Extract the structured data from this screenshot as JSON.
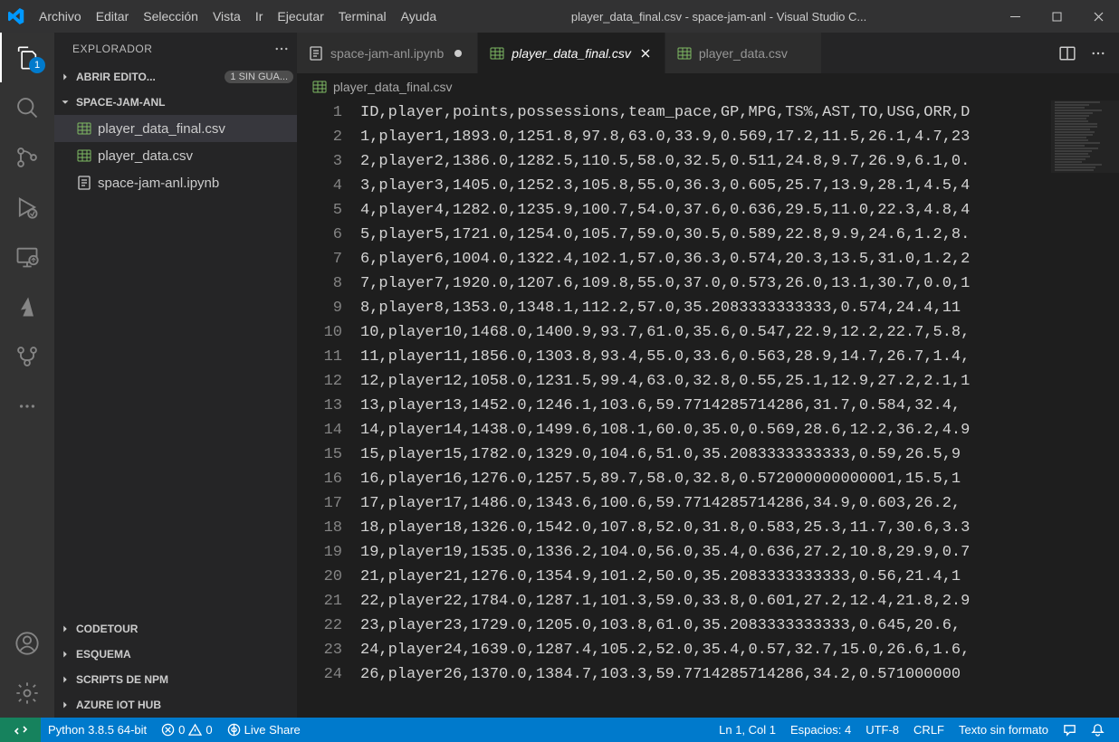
{
  "window": {
    "title": "player_data_final.csv - space-jam-anl - Visual Studio C..."
  },
  "menu": [
    "Archivo",
    "Editar",
    "Selección",
    "Vista",
    "Ir",
    "Ejecutar",
    "Terminal",
    "Ayuda"
  ],
  "activity": {
    "explorer_badge": "1"
  },
  "explorer": {
    "title": "EXPLORADOR",
    "open_editors_label": "ABRIR EDITO...",
    "unsaved_badge": "1 SIN GUA...",
    "folder_name": "SPACE-JAM-ANL",
    "files": [
      {
        "name": "player_data_final.csv",
        "type": "csv",
        "selected": true
      },
      {
        "name": "player_data.csv",
        "type": "csv",
        "selected": false
      },
      {
        "name": "space-jam-anl.ipynb",
        "type": "ipynb",
        "selected": false
      }
    ],
    "panels": [
      "CODETOUR",
      "ESQUEMA",
      "SCRIPTS DE NPM",
      "AZURE IOT HUB"
    ]
  },
  "tabs": [
    {
      "label": "space-jam-anl.ipynb",
      "type": "ipynb",
      "dirty": true,
      "active": false
    },
    {
      "label": "player_data_final.csv",
      "type": "csv",
      "dirty": false,
      "active": true
    },
    {
      "label": "player_data.csv",
      "type": "csv",
      "dirty": false,
      "active": false
    }
  ],
  "breadcrumb": {
    "file": "player_data_final.csv"
  },
  "editor": {
    "lines": [
      "ID,player,points,possessions,team_pace,GP,MPG,TS%,AST,TO,USG,ORR,D",
      "1,player1,1893.0,1251.8,97.8,63.0,33.9,0.569,17.2,11.5,26.1,4.7,23",
      "2,player2,1386.0,1282.5,110.5,58.0,32.5,0.511,24.8,9.7,26.9,6.1,0.",
      "3,player3,1405.0,1252.3,105.8,55.0,36.3,0.605,25.7,13.9,28.1,4.5,4",
      "4,player4,1282.0,1235.9,100.7,54.0,37.6,0.636,29.5,11.0,22.3,4.8,4",
      "5,player5,1721.0,1254.0,105.7,59.0,30.5,0.589,22.8,9.9,24.6,1.2,8.",
      "6,player6,1004.0,1322.4,102.1,57.0,36.3,0.574,20.3,13.5,31.0,1.2,2",
      "7,player7,1920.0,1207.6,109.8,55.0,37.0,0.573,26.0,13.1,30.7,0.0,1",
      "8,player8,1353.0,1348.1,112.2,57.0,35.2083333333333,0.574,24.4,11",
      "10,player10,1468.0,1400.9,93.7,61.0,35.6,0.547,22.9,12.2,22.7,5.8,",
      "11,player11,1856.0,1303.8,93.4,55.0,33.6,0.563,28.9,14.7,26.7,1.4,",
      "12,player12,1058.0,1231.5,99.4,63.0,32.8,0.55,25.1,12.9,27.2,2.1,1",
      "13,player13,1452.0,1246.1,103.6,59.7714285714286,31.7,0.584,32.4,",
      "14,player14,1438.0,1499.6,108.1,60.0,35.0,0.569,28.6,12.2,36.2,4.9",
      "15,player15,1782.0,1329.0,104.6,51.0,35.2083333333333,0.59,26.5,9",
      "16,player16,1276.0,1257.5,89.7,58.0,32.8,0.572000000000001,15.5,1",
      "17,player17,1486.0,1343.6,100.6,59.7714285714286,34.9,0.603,26.2,",
      "18,player18,1326.0,1542.0,107.8,52.0,31.8,0.583,25.3,11.7,30.6,3.3",
      "19,player19,1535.0,1336.2,104.0,56.0,35.4,0.636,27.2,10.8,29.9,0.7",
      "21,player21,1276.0,1354.9,101.2,50.0,35.2083333333333,0.56,21.4,1",
      "22,player22,1784.0,1287.1,101.3,59.0,33.8,0.601,27.2,12.4,21.8,2.9",
      "23,player23,1729.0,1205.0,103.8,61.0,35.2083333333333,0.645,20.6,",
      "24,player24,1639.0,1287.4,105.2,52.0,35.4,0.57,32.7,15.0,26.6,1.6,",
      "26,player26,1370.0,1384.7,103.3,59.7714285714286,34.2,0.571000000"
    ]
  },
  "status": {
    "python": "Python 3.8.5 64-bit",
    "errors": "0",
    "warnings": "0",
    "live_share": "Live Share",
    "position": "Ln 1, Col 1",
    "spaces": "Espacios: 4",
    "encoding": "UTF-8",
    "eol": "CRLF",
    "language": "Texto sin formato"
  }
}
